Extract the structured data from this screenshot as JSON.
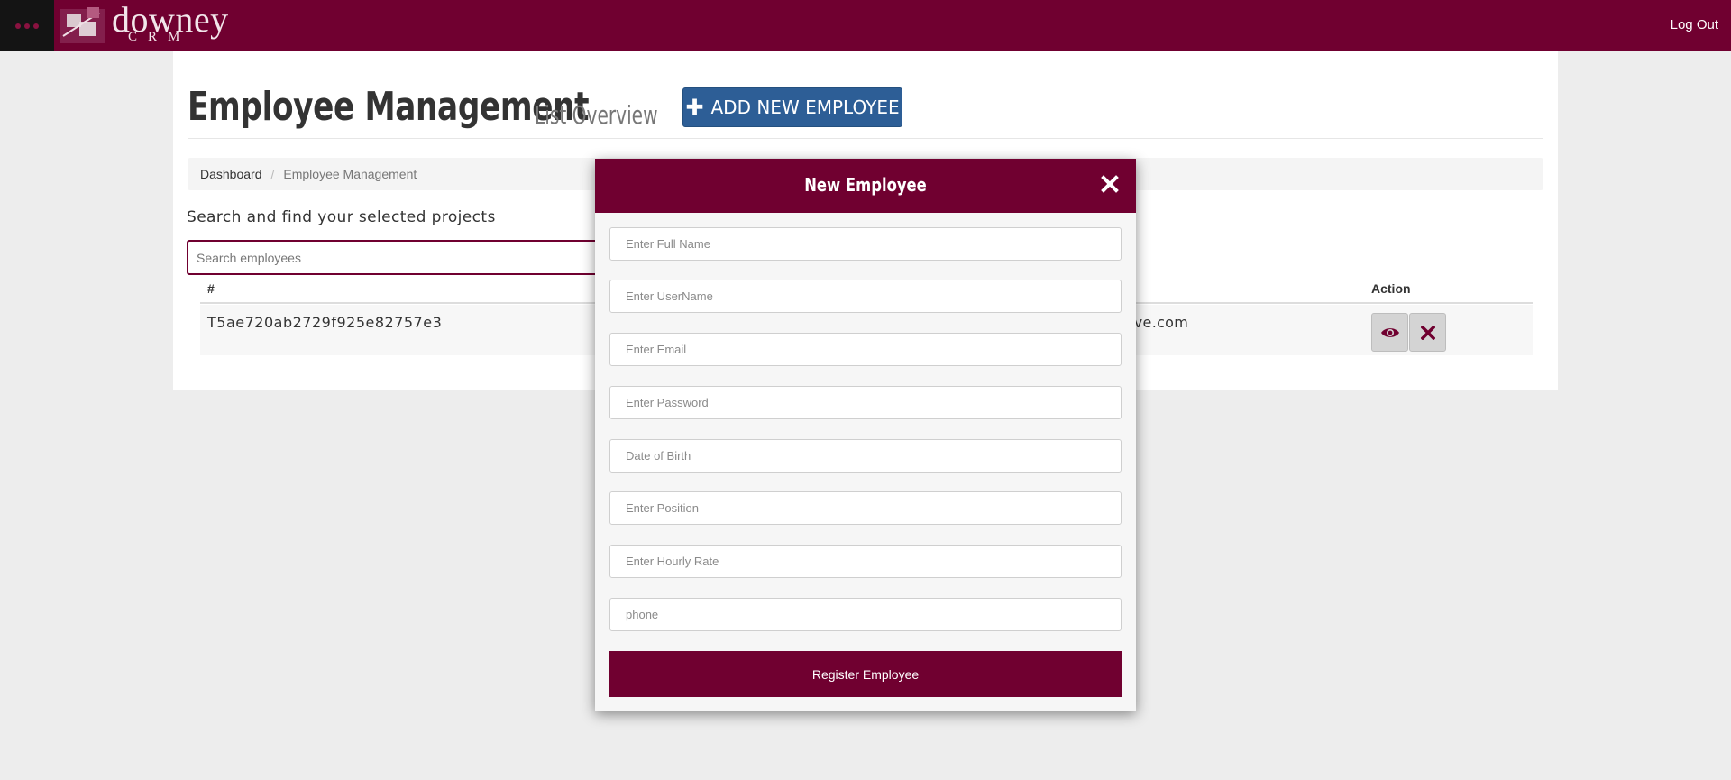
{
  "header": {
    "logo_text": "downey",
    "logo_subtext": "CRM",
    "logout_label": "Log Out"
  },
  "page": {
    "title": "Employee Management",
    "subtitle": "List Overview",
    "add_button_label": "ADD NEW EMPLOYEE"
  },
  "breadcrumb": {
    "items": [
      "Dashboard",
      "Employee Management"
    ],
    "separator": "/"
  },
  "search": {
    "label": "Search and find your selected projects",
    "placeholder": "Search employees",
    "value": ""
  },
  "table": {
    "columns": [
      "#",
      "Action"
    ],
    "rows": [
      {
        "id": "T5ae720ab2729f925e82757e3",
        "email_visible": "@live.com"
      }
    ]
  },
  "modal": {
    "title": "New Employee",
    "fields": [
      {
        "placeholder": "Enter Full Name",
        "value": ""
      },
      {
        "placeholder": "Enter UserName",
        "value": ""
      },
      {
        "placeholder": "Enter Email",
        "value": ""
      },
      {
        "placeholder": "Enter Password",
        "value": ""
      },
      {
        "placeholder": "Date of Birth",
        "value": ""
      },
      {
        "placeholder": "Enter Position",
        "value": ""
      },
      {
        "placeholder": "Enter Hourly Rate",
        "value": ""
      },
      {
        "placeholder": "phone",
        "value": ""
      }
    ],
    "submit_label": "Register Employee"
  },
  "icons": {
    "menu": "menu-dots-icon",
    "plus": "plus-icon",
    "view": "eye-icon",
    "delete": "x-icon",
    "close": "close-icon"
  },
  "colors": {
    "brand": "#700030",
    "primary_button": "#2d5e96",
    "background": "#ededed"
  }
}
